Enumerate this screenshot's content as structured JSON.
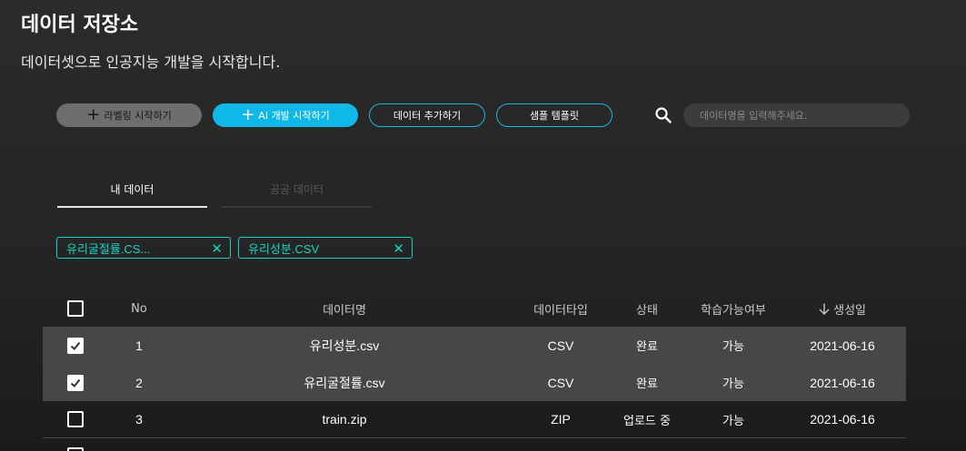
{
  "page": {
    "title": "데이터 저장소",
    "subtitle": "데이터셋으로 인공지능 개발을 시작합니다."
  },
  "toolbar": {
    "label_start": "라벨링 시작하기",
    "ai_start": "AI 개발 시작하기",
    "add_data": "데이터 추가하기",
    "sample_template": "샘플 템플릿",
    "plus_icon": "plus-icon",
    "search_icon": "search-icon",
    "search_placeholder": "데이터명을 입력해주세요.",
    "search_value": ""
  },
  "tabs": [
    {
      "label": "내 데이터",
      "active": true
    },
    {
      "label": "공공 데이터",
      "active": false
    }
  ],
  "chips": [
    {
      "label": "유리굴절률.CS...",
      "close": "✕"
    },
    {
      "label": "유리성분.CSV",
      "close": "✕"
    }
  ],
  "table": {
    "headers": {
      "no": "No",
      "name": "데이터명",
      "type": "데이터타입",
      "status": "상태",
      "learnable": "학습가능여부",
      "date": "생성일",
      "sort_icon": "arrow-down-icon"
    },
    "rows": [
      {
        "no": "1",
        "name": "유리성분.csv",
        "type": "CSV",
        "status": "완료",
        "learnable": "가능",
        "date": "2021-06-16",
        "checked": true
      },
      {
        "no": "2",
        "name": "유리굴절률.csv",
        "type": "CSV",
        "status": "완료",
        "learnable": "가능",
        "date": "2021-06-16",
        "checked": true
      },
      {
        "no": "3",
        "name": "train.zip",
        "type": "ZIP",
        "status": "업로드 중",
        "learnable": "가능",
        "date": "2021-06-16",
        "checked": false
      }
    ]
  },
  "colors": {
    "accent": "#10b8e8",
    "chip": "#17d4c2",
    "selected_row": "#474747"
  }
}
